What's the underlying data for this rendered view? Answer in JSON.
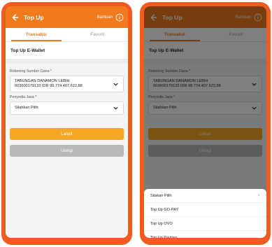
{
  "screens": {
    "left": {
      "title": "Top Up",
      "help": "Bantuan",
      "tabs": [
        "Transaksi",
        "Favorit"
      ],
      "section": "Top Up E-Wallet",
      "source_label": "Rekening Sumber Dana *",
      "source_value_line1": "TABUNGAN DANAMON LEBIH",
      "source_value_line2": "003600179133 IDR 99.774.407.622,88",
      "provider_label": "Penyedia Jasa *",
      "provider_value": "Silahkan Pilih",
      "primary_button": "Lanjut",
      "secondary_button": "Ulangi"
    },
    "right": {
      "title": "Top Up",
      "help": "Bantuan",
      "tabs": [
        "Transaksi",
        "Favorit"
      ],
      "section": "Top Up E-Wallet",
      "source_label": "Rekening Sumber Dana *",
      "source_value_line1": "TABUNGAN DANAMON LEBIH",
      "source_value_line2": "003600179133 IDR 99.774.407.622,88",
      "provider_label": "Penyedia Jasa *",
      "provider_value": "Silahkan Pilih",
      "primary_button": "Lanjut",
      "secondary_button": "Ulangi",
      "sheet": {
        "header": "Silakan Pilih",
        "close": "×",
        "options": [
          "Top Up GO-PAY",
          "Top Up OVO",
          "Top Up Paytren"
        ]
      }
    }
  },
  "colors": {
    "frame": "#f25a1f",
    "appbar": "#f07a1c",
    "primary_button": "#f5a623",
    "secondary_button": "#b8b8b8"
  }
}
